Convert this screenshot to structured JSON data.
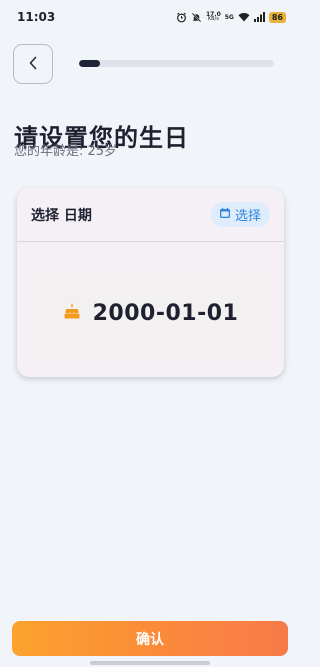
{
  "status_bar": {
    "time": "11:03",
    "net_speed_value": "17.0",
    "net_speed_unit": "KB/s",
    "network": "5G",
    "battery": "86",
    "icons": [
      "alarm-icon",
      "mute-icon",
      "wifi-icon",
      "signal-icon",
      "battery-icon"
    ]
  },
  "header": {
    "back_icon": "chevron-left-icon",
    "progress_fraction": 0.11
  },
  "page": {
    "title": "请设置您的生日",
    "age_text": "您的年龄是: 25岁"
  },
  "card": {
    "title": "选择 日期",
    "select_label": "选择",
    "select_icon": "calendar-icon",
    "date_icon": "cake-icon",
    "date_value": "2000-01-01"
  },
  "footer": {
    "confirm_label": "确认"
  },
  "colors": {
    "accent_start": "#fca22d",
    "accent_end": "#f77a4a",
    "link_blue": "#2f86de",
    "cake_orange": "#f39a1e",
    "progress_dark": "#1f2537"
  }
}
